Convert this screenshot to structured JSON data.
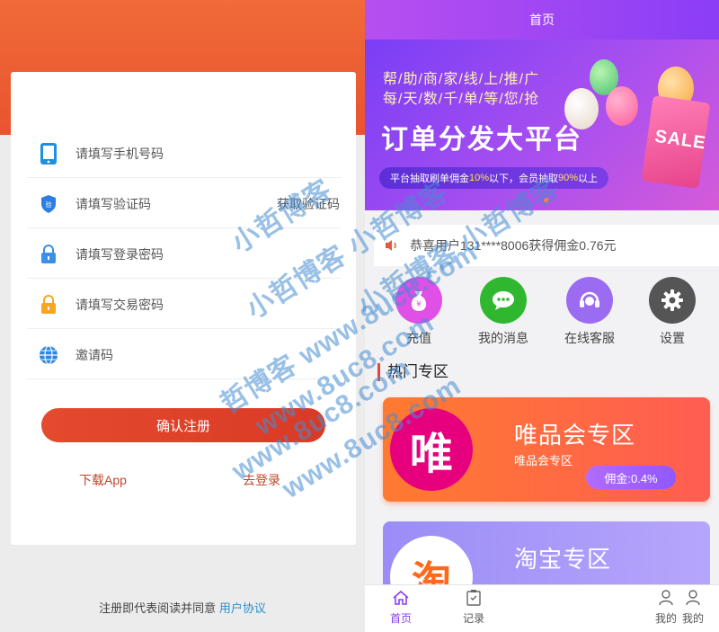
{
  "register": {
    "phone_placeholder": "请填写手机号码",
    "code_placeholder": "请填写验证码",
    "get_code_label": "获取验证码",
    "login_password_placeholder": "请填写登录密码",
    "trade_password_placeholder": "请填写交易密码",
    "invite_placeholder": "邀请码",
    "confirm_label": "确认注册",
    "download_label": "下载App",
    "login_label": "去登录",
    "agreement_prefix": "注册即代表阅读并同意",
    "agreement_link": "用户协议"
  },
  "home": {
    "title": "首页",
    "banner": {
      "line1": "帮/助/商/家/线/上/推/广",
      "line2": "每/天/数/千/单/等/您/抢",
      "headline": "订单分发大平台",
      "pill_a": "平台抽取刷单佣金",
      "pill_b": "10%",
      "pill_c": "以下，会员抽取",
      "pill_d": "90%",
      "pill_e": "以上",
      "sale": "SALE"
    },
    "notice": "恭喜用户131****8006获得佣金0.76元",
    "quick": [
      {
        "label": "充值",
        "icon": "money-bag-icon",
        "color": "#e04fe6"
      },
      {
        "label": "我的消息",
        "icon": "chat-icon",
        "color": "#2fb82f"
      },
      {
        "label": "在线客服",
        "icon": "headset-icon",
        "color": "#9b6cf2"
      },
      {
        "label": "设置",
        "icon": "gear-icon",
        "color": "#555555"
      }
    ],
    "section_title": "热门专区",
    "promos": [
      {
        "title": "唯品会专区",
        "subtitle": "唯品会专区",
        "rate": "佣金:0.4%",
        "logo": "唯"
      },
      {
        "title": "淘宝专区",
        "subtitle": "",
        "rate": "",
        "logo": "淘"
      }
    ],
    "tabs": [
      {
        "label": "首页",
        "icon": "home-icon"
      },
      {
        "label": "记录",
        "icon": "record-icon"
      },
      {
        "label": "我的",
        "icon": "user-icon"
      },
      {
        "label": "我的",
        "icon": "user-icon"
      }
    ]
  },
  "watermark": {
    "w1": "小哲博客",
    "w2": "小哲博客 小哲博客",
    "w3": "小哲博客 小哲博客",
    "w4": "哲博客 www.8uc8.com",
    "w5": "www.8uc8.com",
    "w6": "www.8uc8.com",
    "w7": "www.8uc8.com"
  },
  "colors": {
    "accent_orange": "#e44a2e",
    "accent_purple": "#8a3ef6",
    "link_blue": "#2a8fd0"
  }
}
